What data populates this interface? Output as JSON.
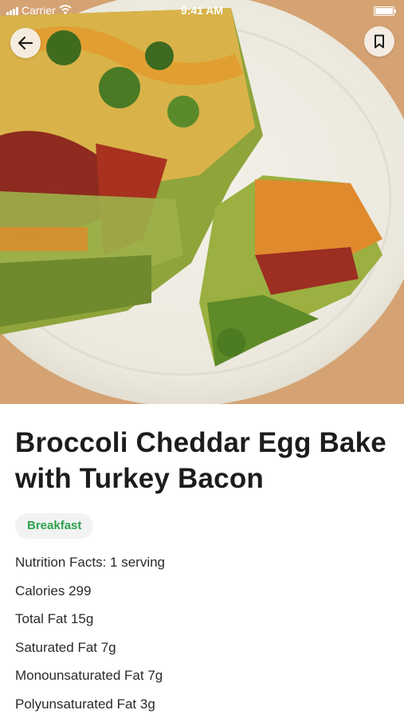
{
  "status_bar": {
    "carrier": "Carrier",
    "time": "9:41 AM"
  },
  "hero": {
    "image_subject": "broccoli cheddar egg bake with turkey bacon on a plate"
  },
  "nav": {
    "back_icon": "arrow-left-icon",
    "bookmark_icon": "bookmark-icon"
  },
  "recipe": {
    "title": "Broccoli Cheddar Egg Bake with Turkey Bacon",
    "tag": "Breakfast",
    "nutrition": [
      "Nutrition Facts: 1 serving",
      "Calories 299",
      "Total Fat 15g",
      "Saturated Fat 7g",
      "Monounsaturated Fat 7g",
      "Polyunsaturated Fat 3g"
    ]
  },
  "colors": {
    "tag_text": "#2ca24d",
    "tag_bg": "#f1f2f2",
    "title_text": "#1c1c1c"
  }
}
